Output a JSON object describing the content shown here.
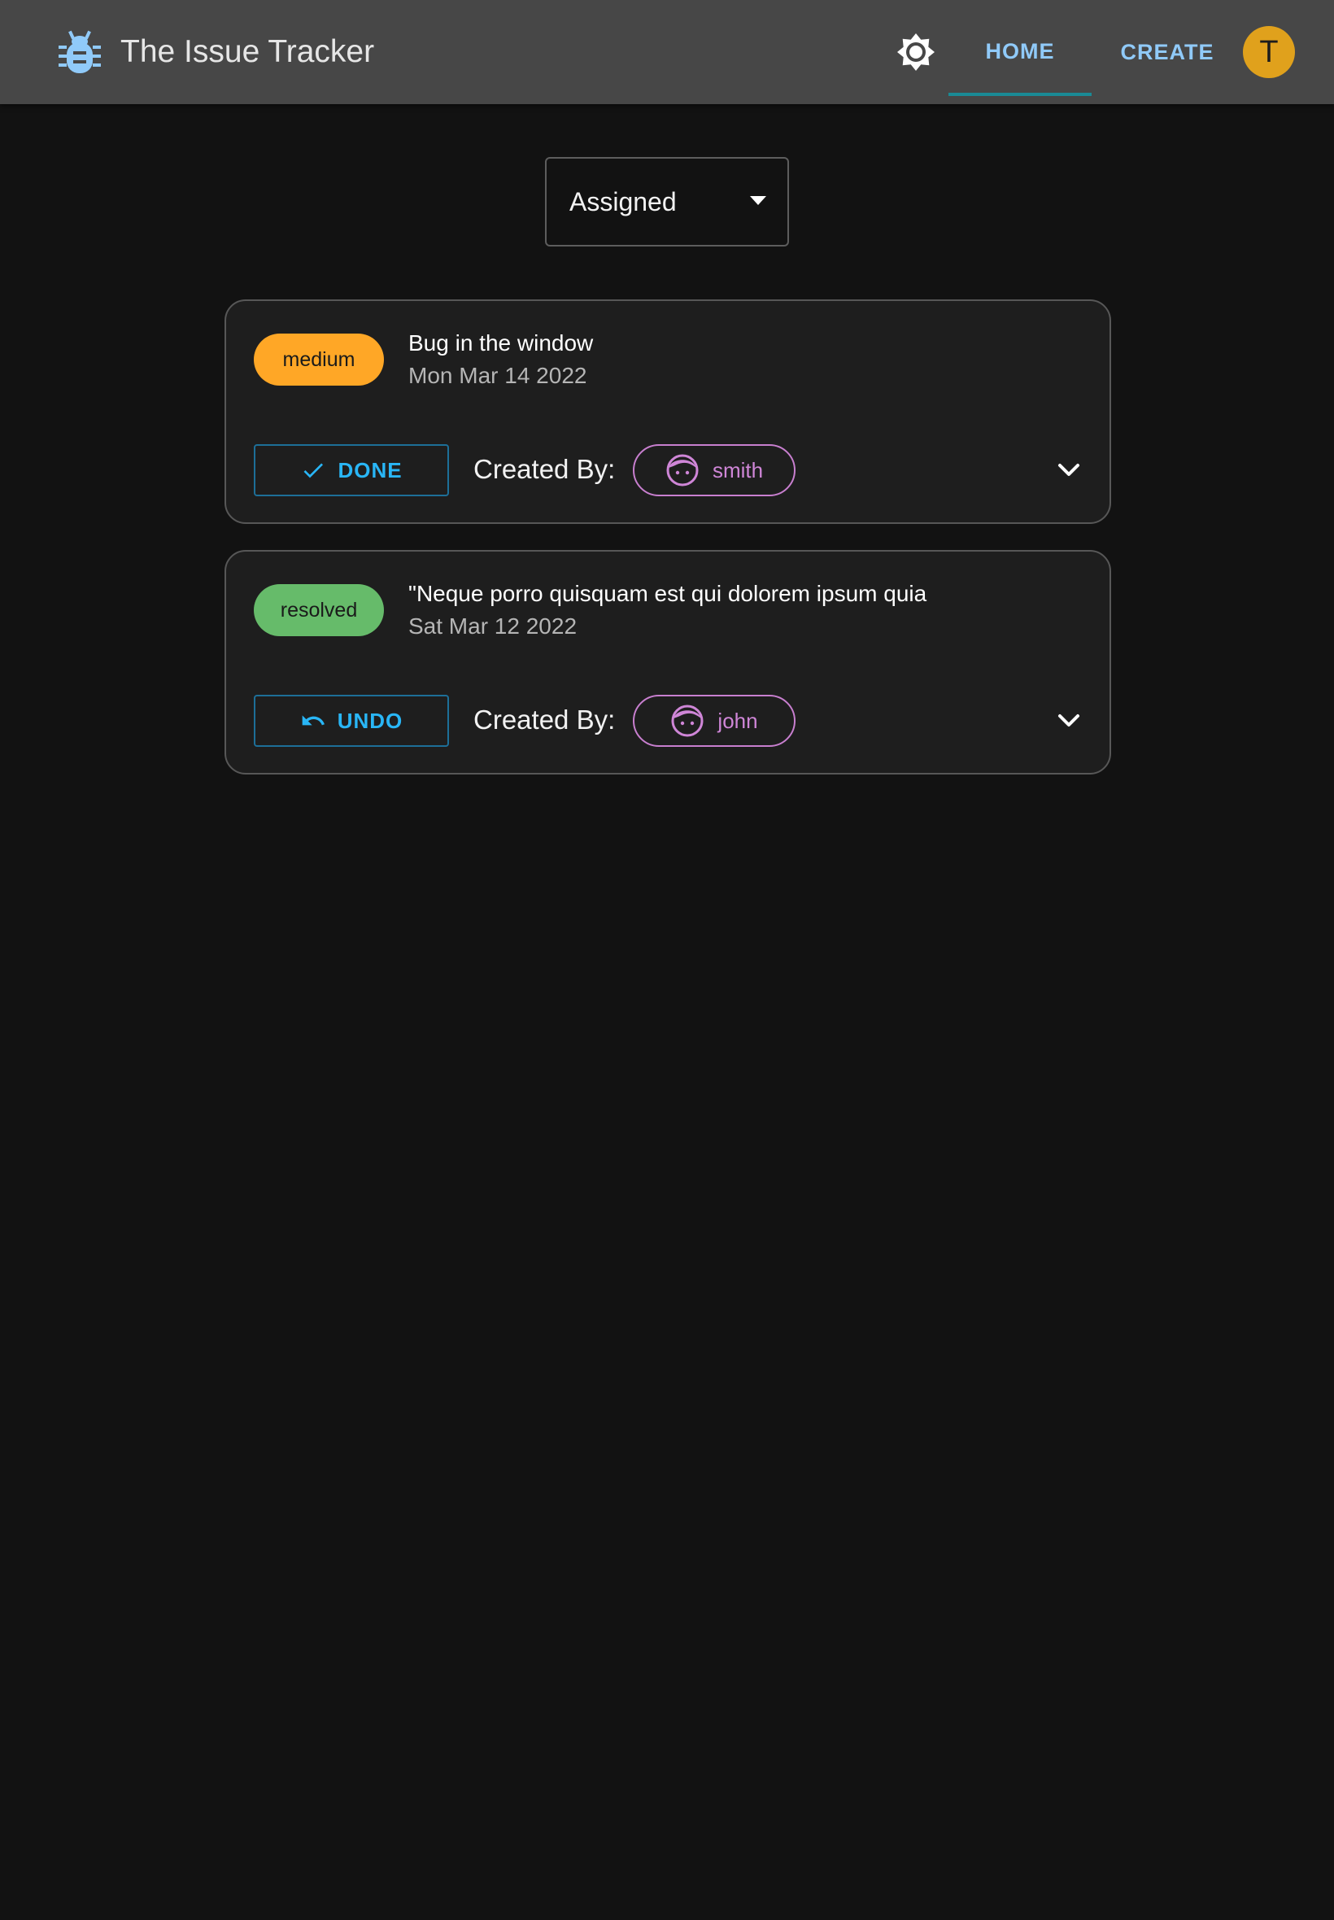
{
  "colors": {
    "appbar_bg": "#474747",
    "page_bg": "#121212",
    "card_bg": "#1e1e1e",
    "accent_blue": "#90caf9",
    "action_blue": "#29b6f6",
    "tab_indicator": "#1a8a95",
    "avatar_bg": "#e0a11c",
    "user_chip": "#cf86d7",
    "priority_medium": "#ffa726",
    "priority_resolved": "#66bb6a"
  },
  "header": {
    "app_icon": "bug-icon",
    "app_title": "The Issue Tracker",
    "theme_icon": "brightness-icon",
    "nav": {
      "home_label": "HOME",
      "create_label": "CREATE",
      "active": "HOME"
    },
    "avatar_initial": "T"
  },
  "filter": {
    "selected": "Assigned"
  },
  "issues": [
    {
      "priority": "medium",
      "priority_color": "#ffa726",
      "title": "Bug in the window",
      "date": "Mon Mar 14 2022",
      "action_label": "DONE",
      "action_icon": "check-icon",
      "created_by_label": "Created By:",
      "creator": "smith",
      "creator_icon": "face-icon",
      "expand_icon": "chevron-down-icon"
    },
    {
      "priority": "resolved",
      "priority_color": "#66bb6a",
      "title": "\"Neque porro quisquam est qui dolorem ipsum quia",
      "date": "Sat Mar 12 2022",
      "action_label": "UNDO",
      "action_icon": "undo-icon",
      "created_by_label": "Created By:",
      "creator": "john",
      "creator_icon": "face-icon",
      "expand_icon": "chevron-down-icon"
    }
  ]
}
